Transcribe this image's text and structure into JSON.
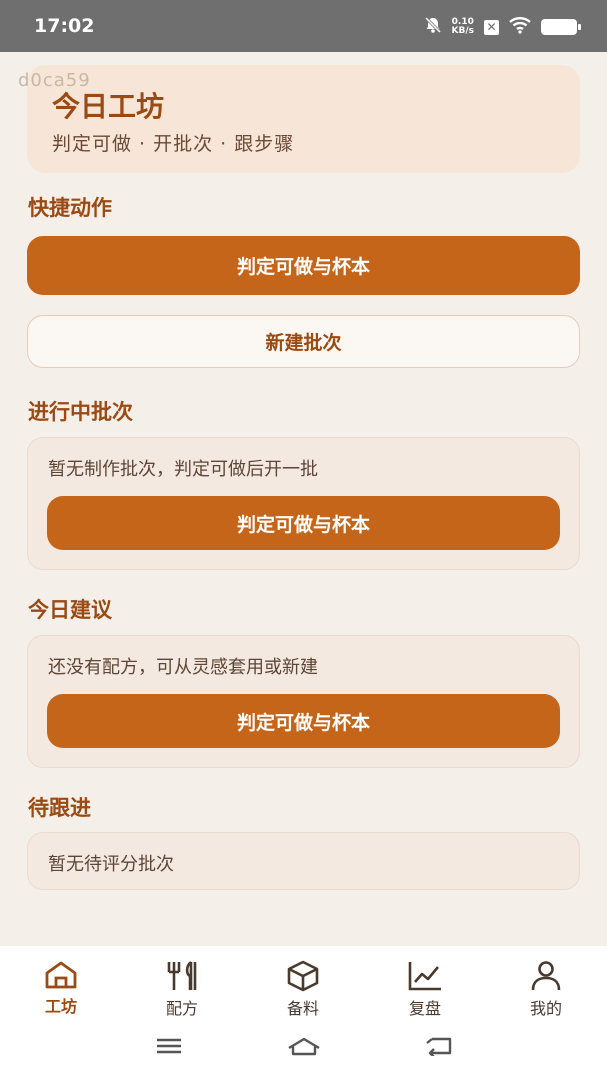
{
  "status": {
    "time": "17:02",
    "net_speed_value": "0.10",
    "net_speed_unit": "KB/s"
  },
  "watermark": "d0ca59",
  "header": {
    "title": "今日工坊",
    "subtitle": "判定可做 · 开批次 · 跟步骤"
  },
  "quick_actions": {
    "title": "快捷动作",
    "primary_label": "判定可做与杯本",
    "secondary_label": "新建批次"
  },
  "in_progress": {
    "title": "进行中批次",
    "empty_text": "暂无制作批次，判定可做后开一批",
    "button_label": "判定可做与杯本"
  },
  "suggestions": {
    "title": "今日建议",
    "empty_text": "还没有配方，可从灵感套用或新建",
    "button_label": "判定可做与杯本"
  },
  "follow_up": {
    "title": "待跟进",
    "empty_text": "暂无待评分批次"
  },
  "tabs": [
    {
      "label": "工坊",
      "icon": "home-icon",
      "active": true
    },
    {
      "label": "配方",
      "icon": "utensils-icon",
      "active": false
    },
    {
      "label": "备料",
      "icon": "box-icon",
      "active": false
    },
    {
      "label": "复盘",
      "icon": "chart-icon",
      "active": false
    },
    {
      "label": "我的",
      "icon": "user-icon",
      "active": false
    }
  ],
  "colors": {
    "accent": "#c4651a",
    "title_brown": "#9a4a12",
    "background": "#f5efe9",
    "hero_bg": "#f7e6d8"
  }
}
